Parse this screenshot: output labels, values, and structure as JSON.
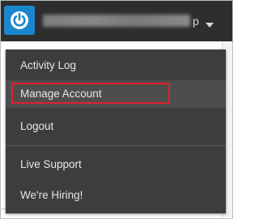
{
  "header": {
    "logo_icon": "power-icon",
    "account_name_suffix": "p",
    "caret_icon": "caret-down-icon",
    "brand_color": "#1a87cc"
  },
  "menu": {
    "items": [
      {
        "label": "Activity Log"
      },
      {
        "label": "Manage Account",
        "highlighted": true
      },
      {
        "label": "Logout"
      },
      {
        "label": "Live Support"
      },
      {
        "label": "We're Hiring!"
      }
    ],
    "highlight_color": "#e0202e"
  }
}
